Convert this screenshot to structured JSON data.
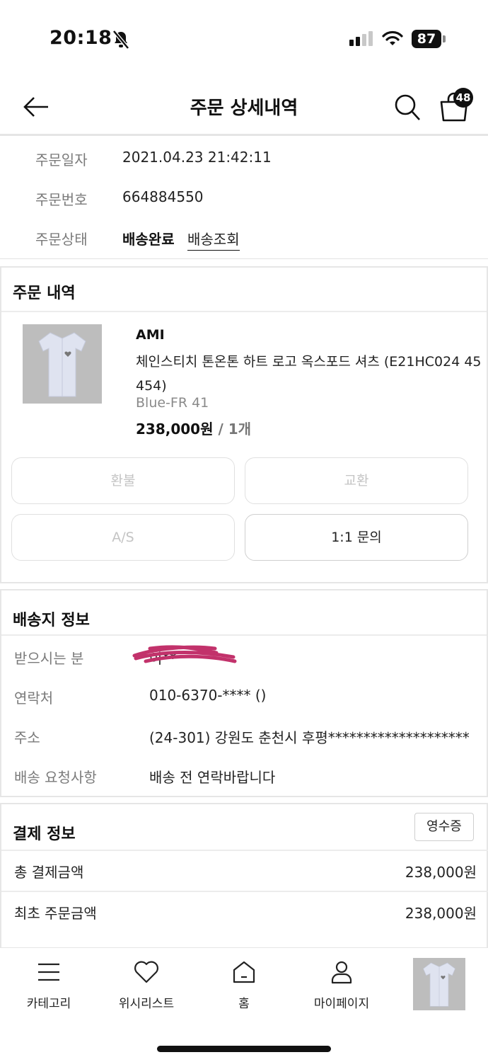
{
  "status_bar": {
    "time": "20:18",
    "battery": "87"
  },
  "header": {
    "title": "주문 상세내역",
    "cart_count": "48"
  },
  "order": {
    "date_label": "주문일자",
    "date_value": "2021.04.23 21:42:11",
    "number_label": "주문번호",
    "number_value": "664884550",
    "status_label": "주문상태",
    "status_value": "배송완료",
    "tracking_link": "배송조회"
  },
  "order_items": {
    "title": "주문 내역",
    "brand": "AMI",
    "product_name": "체인스티치 톤온톤 하트 로고 옥스포드 셔츠 (E21HC024 45 454)",
    "option": "Blue-FR 41",
    "price": "238,000원",
    "quantity": " / 1개",
    "buttons": {
      "refund": "환불",
      "exchange": "교환",
      "as": "A/S",
      "inquiry": "1:1 문의"
    }
  },
  "shipping": {
    "title": "배송지 정보",
    "recipient_label": "받으시는 분",
    "recipient_value": "이**",
    "phone_label": "연락처",
    "phone_value": "010-6370-**** ()",
    "address_label": "주소",
    "address_value": "(24-301) 강원도 춘천시 후평********************",
    "request_label": "배송 요청사항",
    "request_value": "배송 전 연락바랍니다"
  },
  "payment": {
    "title": "결제 정보",
    "receipt_button": "영수증",
    "total_label": "총 결제금액",
    "total_value": "238,000원",
    "original_label": "최초 주문금액",
    "original_value": "238,000원"
  },
  "tab_bar": {
    "category": "카테고리",
    "wishlist": "위시리스트",
    "home": "홈",
    "mypage": "마이페이지"
  },
  "colors": {
    "accent": "#111111",
    "redaction": "#c2326b",
    "muted_text": "#7a7a7a",
    "disabled_text": "#c4c4c4"
  }
}
